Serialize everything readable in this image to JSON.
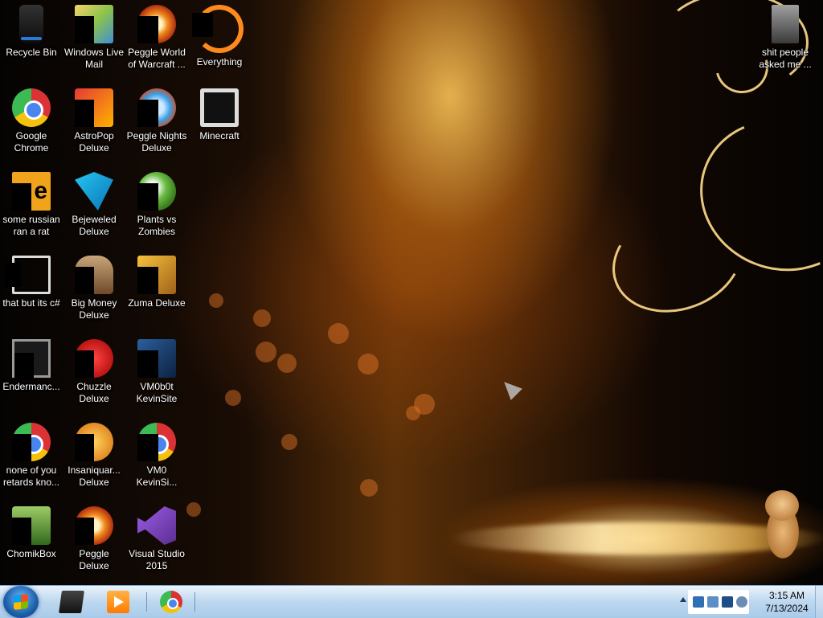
{
  "desktop": {
    "icons": [
      {
        "label": "Recycle Bin"
      },
      {
        "label": "Windows Live Mail"
      },
      {
        "label": "Peggle World of Warcraft ..."
      },
      {
        "label": "Everything"
      },
      {
        "label": "Google Chrome"
      },
      {
        "label": "AstroPop Deluxe"
      },
      {
        "label": "Peggle Nights Deluxe"
      },
      {
        "label": "Minecraft"
      },
      {
        "label": "some russian ran a rat"
      },
      {
        "label": "Bejeweled Deluxe"
      },
      {
        "label": "Plants vs Zombies"
      },
      {
        "label": "that but its c#"
      },
      {
        "label": "Big Money Deluxe"
      },
      {
        "label": "Zuma Deluxe"
      },
      {
        "label": "Endermanc..."
      },
      {
        "label": "Chuzzle Deluxe"
      },
      {
        "label": "VM0b0t KevinSite"
      },
      {
        "label": "none of you retards kno..."
      },
      {
        "label": "Insaniquar... Deluxe"
      },
      {
        "label": "VM0 KevinSi..."
      },
      {
        "label": "ChomikBox"
      },
      {
        "label": "Peggle Deluxe"
      },
      {
        "label": "Visual Studio 2015"
      }
    ],
    "right_icon": {
      "label": "shit people asked me ..."
    }
  },
  "taskbar": {
    "start_icon": "windows-flag-icon",
    "pinned": [
      {
        "icon": "terminal-icon"
      },
      {
        "icon": "media-player-icon"
      },
      {
        "icon": "chrome-icon"
      }
    ],
    "clock": {
      "time": "3:15 AM",
      "date": "7/13/2024"
    }
  },
  "colors": {
    "taskbar": "#bcd7ef",
    "accent": "#1d5fa8"
  }
}
